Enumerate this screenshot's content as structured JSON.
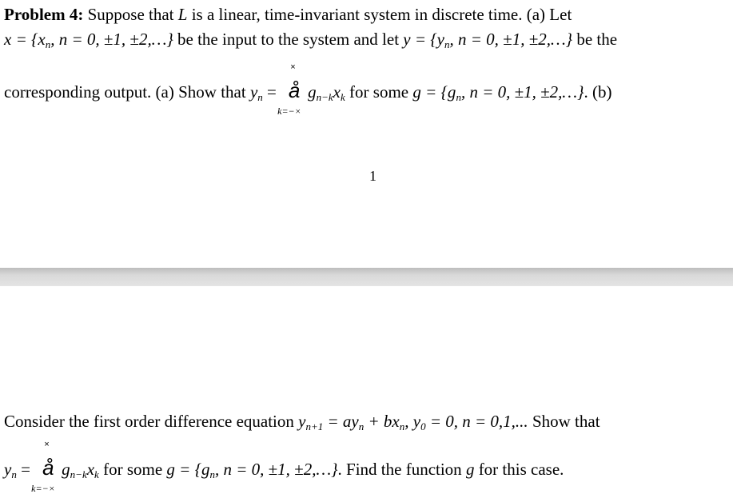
{
  "page1": {
    "heading": "Problem 4:",
    "line1_text": " Suppose that ",
    "L": "L",
    "line1_rest": " is a linear, time-invariant system in discrete time. (a) Let",
    "x_def": "x = {x",
    "x_def_rest": ", n = 0, ±1, ±2,…}",
    "line2_mid": " be the input to the system and let ",
    "y_def": "y = {y",
    "y_def_rest": ", n = 0, ±1, ±2,…}",
    "line2_end": " be the",
    "line3_start": "corresponding output. (a) Show that ",
    "yn": "y",
    "eq": " = ",
    "sum_symbol": "å",
    "sum_top": "×",
    "sum_bottom": "k=−×",
    "g": "g",
    "g_sub": "n−k",
    "x": "x",
    "x_sub": "k",
    "for_some": " for some ",
    "g_def": "g = {g",
    "g_def_rest": ", n = 0, ±1, ±2,…}",
    "line3_end": ". (b)",
    "sub_n": "n",
    "page_number": "1"
  },
  "page2": {
    "line1_start": "Consider the first order difference equation ",
    "y": "y",
    "y_sub": "n+1",
    "eq_rest": " = ay",
    "plus": " + bx",
    "comma_y0": ", y",
    "y0_sub": "0",
    "tail": " = 0, n = 0,1,...",
    "show_that": " Show that",
    "line2_yn": "y",
    "line2_for_some": " for some ",
    "line2_end": ". Find the function ",
    "g_word": "g",
    "for_case": " for this case."
  }
}
